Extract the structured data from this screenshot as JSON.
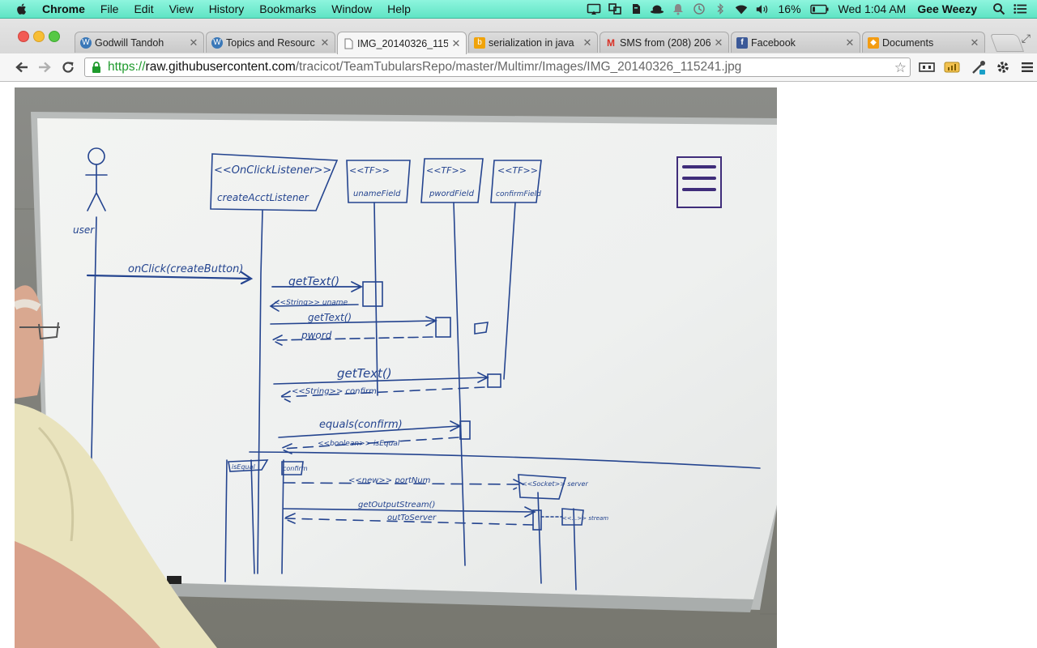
{
  "menubar": {
    "app": "Chrome",
    "menus": [
      "File",
      "Edit",
      "View",
      "History",
      "Bookmarks",
      "Window",
      "Help"
    ],
    "battery": "16%",
    "clock": "Wed 1:04 AM",
    "user": "Gee Weezy",
    "status_icons": [
      "airplay-icon",
      "dropbox-icon",
      "evernote-icon",
      "bowler-hat-icon",
      "notification-bell-icon",
      "time-machine-icon",
      "bluetooth-icon",
      "wifi-icon",
      "volume-icon",
      "battery-icon",
      "spotlight-icon",
      "notification-center-icon"
    ]
  },
  "tabs": [
    {
      "title": "Godwill Tandoh",
      "icon": "wordpress-icon",
      "color": "#3a78b8"
    },
    {
      "title": "Topics and Resourc",
      "icon": "wordpress-icon",
      "color": "#3a78b8"
    },
    {
      "title": "IMG_20140326_115",
      "icon": "page-icon",
      "color": "#888888",
      "active": true
    },
    {
      "title": "serialization in java",
      "icon": "bing-icon",
      "color": "#f0a30a"
    },
    {
      "title": "SMS from (208) 206",
      "icon": "gmail-icon",
      "color": "#d93025"
    },
    {
      "title": "Facebook",
      "icon": "facebook-icon",
      "color": "#3b5998"
    },
    {
      "title": "Documents",
      "icon": "documents-icon",
      "color": "#f39c12"
    }
  ],
  "address": {
    "scheme": "https://",
    "host": "raw.githubusercontent.com",
    "path": "/tracicot/TeamTubularsRepo/master/Multimr/Images/IMG_20140326_115241.jpg"
  },
  "whiteboard": {
    "lifelines": [
      "<<OnClickListener>>",
      "createAcctListener",
      "<<TF>>",
      "unameField",
      "<<TF>>",
      "pwordField",
      "<<TF>>",
      "confirmField"
    ],
    "actor": "user",
    "messages": [
      "onClick(createButton)",
      "getText()",
      "<<String>> uname",
      "getText()",
      "pword",
      "getText()",
      "<<String>> confirm",
      "equals(confirm)",
      "<<boolean>> isEqual",
      "isEqual",
      "confirm",
      "<<new>> portNum",
      "<<Socket>> server",
      "getOutputStream()",
      "outToServer",
      "<<...>> stream"
    ]
  }
}
